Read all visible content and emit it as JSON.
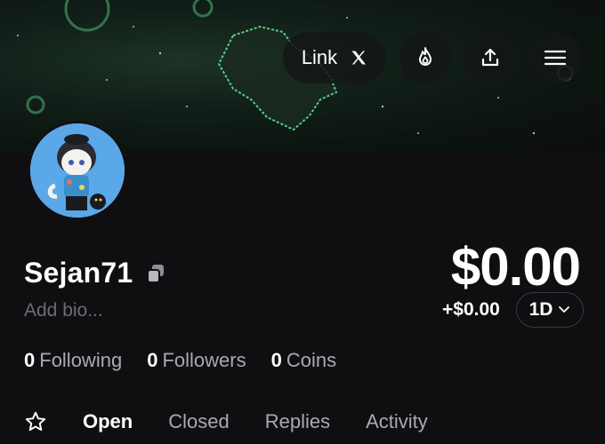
{
  "header": {
    "link_label": "Link",
    "icons": [
      "x-logo-icon",
      "fire-icon",
      "share-icon",
      "menu-icon"
    ]
  },
  "profile": {
    "username": "Sejan71",
    "bio_placeholder": "Add bio...",
    "balance": "$0.00",
    "change": "+$0.00",
    "period": "1D"
  },
  "stats": [
    {
      "count": "0",
      "label": "Following"
    },
    {
      "count": "0",
      "label": "Followers"
    },
    {
      "count": "0",
      "label": "Coins"
    }
  ],
  "tabs": [
    {
      "label": "Open",
      "active": true
    },
    {
      "label": "Closed",
      "active": false
    },
    {
      "label": "Replies",
      "active": false
    },
    {
      "label": "Activity",
      "active": false
    }
  ],
  "colors": {
    "background": "#0f0f12",
    "banner_accent": "#5fe08a",
    "muted_text": "#a9aab0",
    "bio_text": "#6c6d72"
  }
}
